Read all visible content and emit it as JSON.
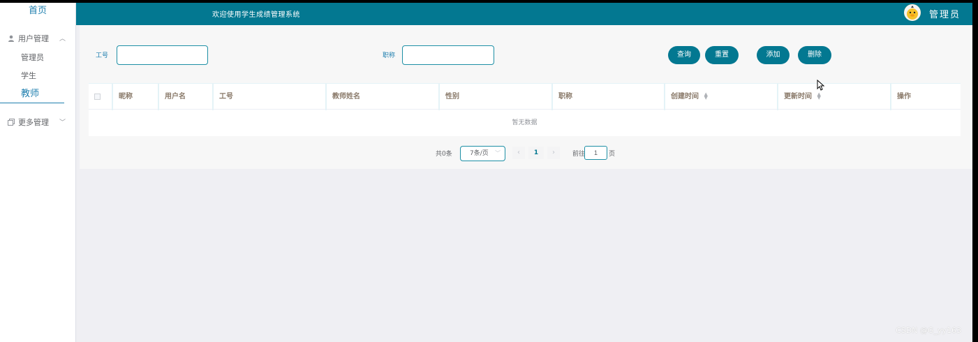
{
  "sidebar": {
    "home_label": "首页",
    "group_user": "用户管理",
    "items": [
      {
        "label": "管理员"
      },
      {
        "label": "学生"
      },
      {
        "label": "教师"
      }
    ],
    "group_more": "更多管理"
  },
  "header": {
    "welcome": "欢迎使用学生成绩管理系统",
    "user": "管理员",
    "bar_color": "#037891"
  },
  "search": {
    "field1_label": "工号",
    "field1_value": "",
    "field2_label": "职称",
    "field2_value": ""
  },
  "buttons": {
    "query": "查询",
    "reset": "重置",
    "add": "添加",
    "delete": "删除"
  },
  "table": {
    "columns": [
      "昵称",
      "用户名",
      "工号",
      "教师姓名",
      "性别",
      "职称",
      "创建时间",
      "更新时间",
      "操作"
    ],
    "empty_text": "暂无数据"
  },
  "pagination": {
    "total_text": "共0条",
    "page_size": "7条/页",
    "current_page": "1",
    "goto_label": "前往",
    "goto_value": "1",
    "page_unit": "页"
  },
  "watermark": "CSDN @G_yy163",
  "icons": {
    "user_group": "user-icon",
    "more_group": "copy-icon",
    "expand": "chevron-up-icon",
    "collapse": "chevron-down-icon"
  }
}
